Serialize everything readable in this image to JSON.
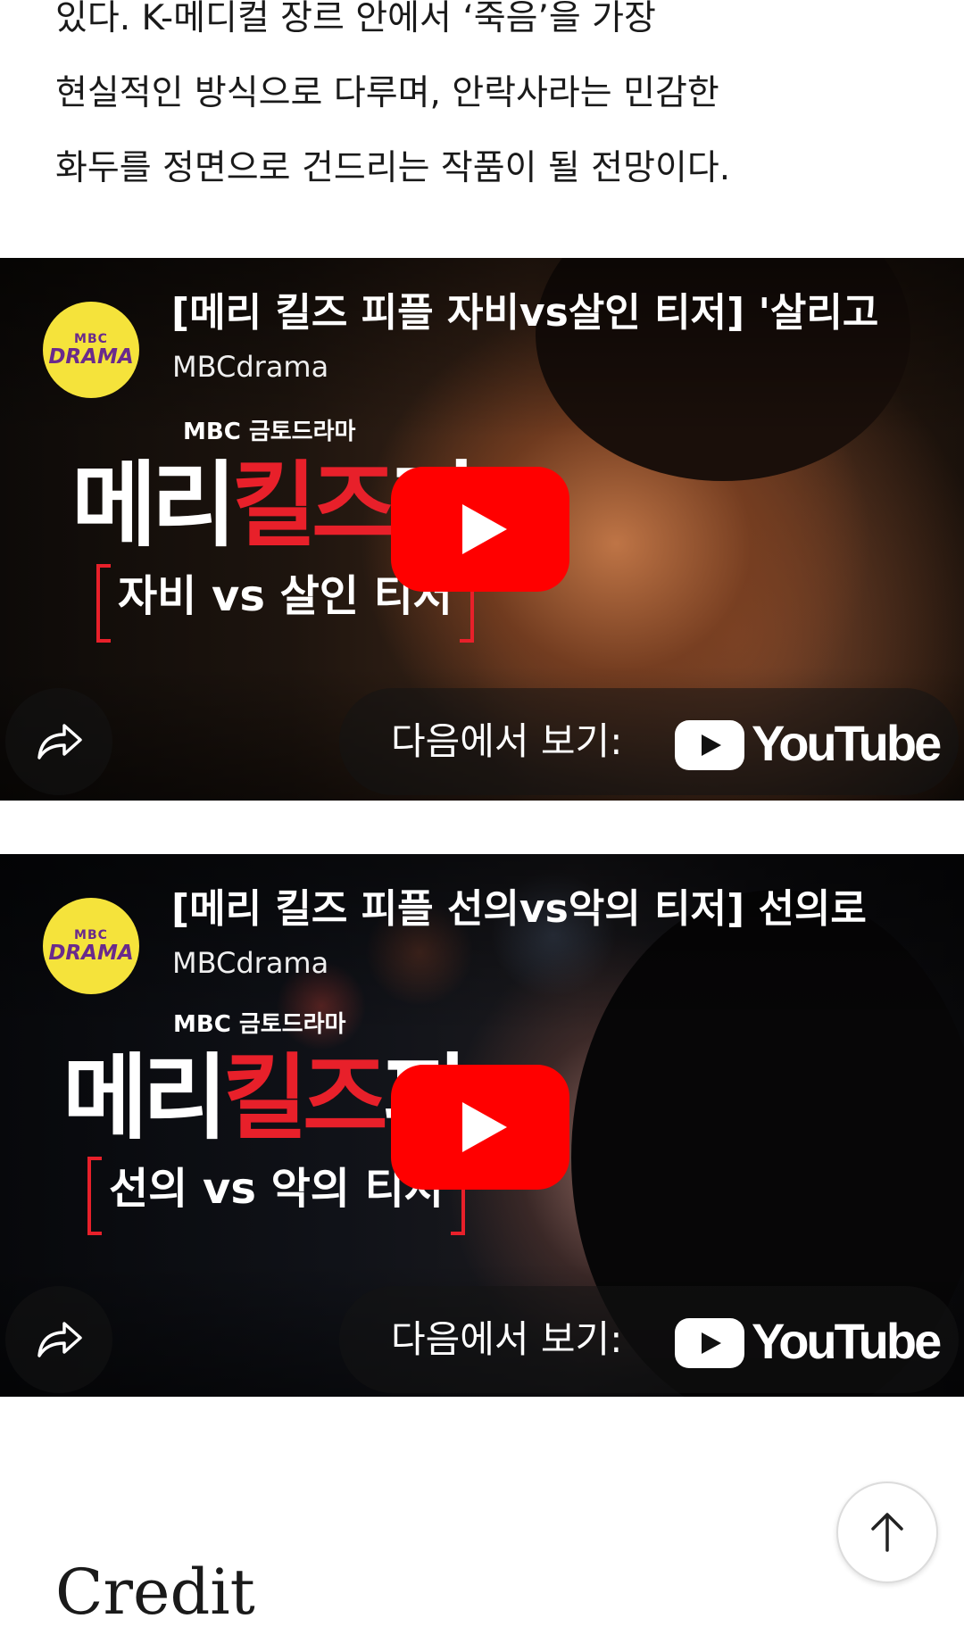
{
  "article": {
    "lines": [
      "있다. K-메디컬 장르 안에서 ‘죽음’을 가장",
      "현실적인 방식으로 다루며, 안락사라는 민감한",
      "화두를 정면으로 건드리는 작품이 될 전망이다."
    ]
  },
  "videos": [
    {
      "title": "[메리 킬즈 피플 자비vs살인 티저] '살리고",
      "channel": "MBCdrama",
      "avatar_top": "MBC",
      "avatar_bottom": "DRAMA",
      "thumb_brand": "MBC 금토드라마",
      "thumb_logo_a": "메리",
      "thumb_logo_b": "킬즈",
      "thumb_logo_c": "피",
      "thumb_sub": "자비 vs 살인 티저",
      "watch_on": "다음에서 보기:",
      "youtube": "YouTube",
      "play_icon": "play-icon",
      "share_icon": "share-arrow-icon"
    },
    {
      "title": "[메리 킬즈 피플 선의vs악의 티저] 선의로",
      "channel": "MBCdrama",
      "avatar_top": "MBC",
      "avatar_bottom": "DRAMA",
      "thumb_brand": "MBC 금토드라마",
      "thumb_logo_a": "메리",
      "thumb_logo_b": "킬즈",
      "thumb_logo_c": "피",
      "thumb_sub": "선의 vs 악의 티저",
      "watch_on": "다음에서 보기:",
      "youtube": "YouTube",
      "play_icon": "play-icon",
      "share_icon": "share-arrow-icon"
    }
  ],
  "footer": {
    "credit_heading": "Credit",
    "back_to_top_icon": "arrow-up-icon"
  },
  "colors": {
    "accent_red": "#ff0000",
    "logo_red": "#e8202a",
    "avatar_yellow": "#f5e33b",
    "avatar_purple": "#6a2a8c",
    "text": "#1a1a1a"
  }
}
